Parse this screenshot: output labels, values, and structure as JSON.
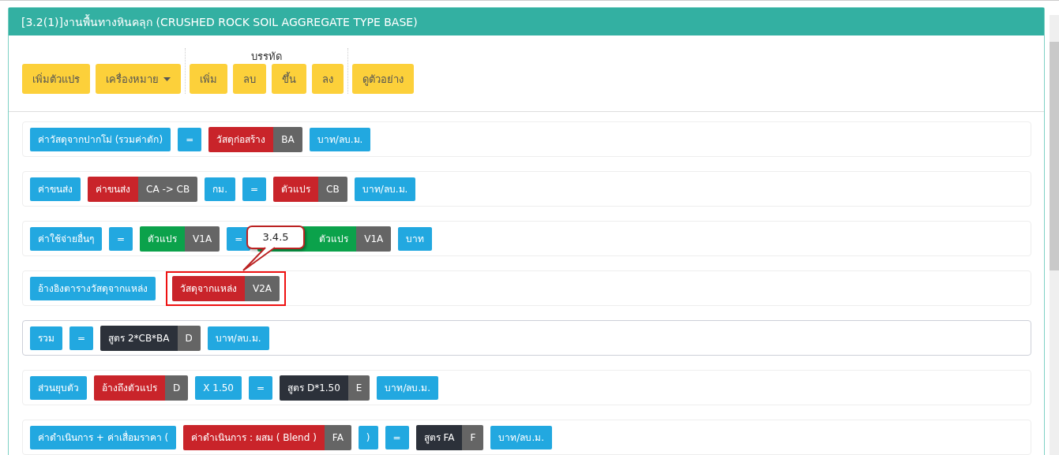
{
  "panel": {
    "title": "[3.2(1)]งานพื้นทางหินคลุก (CRUSHED ROCK SOIL AGGREGATE TYPE BASE)"
  },
  "toolbar": {
    "groups": [
      {
        "buttons": [
          {
            "label": "เพิ่มตัวแปร",
            "dropdown": false
          },
          {
            "label": "เครื่องหมาย",
            "dropdown": true
          }
        ]
      },
      {
        "heading": "บรรทัด",
        "buttons": [
          {
            "label": "เพิ่ม",
            "dropdown": false
          },
          {
            "label": "ลบ",
            "dropdown": false
          },
          {
            "label": "ขึ้น",
            "dropdown": false
          },
          {
            "label": "ลง",
            "dropdown": false
          }
        ]
      },
      {
        "buttons": [
          {
            "label": "ดูตัวอย่าง",
            "dropdown": false
          }
        ]
      }
    ]
  },
  "rows": [
    {
      "selected": false,
      "items": [
        {
          "kind": "text",
          "text": "ค่าวัสดุจากปากโม่ (รวมค่าตัก)"
        },
        {
          "kind": "text",
          "text": "="
        },
        {
          "kind": "ref",
          "text": "วัสดุก่อสร้าง",
          "code": "BA"
        },
        {
          "kind": "text",
          "text": "บาท/ลบ.ม."
        }
      ]
    },
    {
      "selected": false,
      "items": [
        {
          "kind": "text",
          "text": "ค่าขนส่ง"
        },
        {
          "kind": "ref",
          "text": "ค่าขนส่ง",
          "code": "CA -> CB"
        },
        {
          "kind": "text",
          "text": "กม."
        },
        {
          "kind": "text",
          "text": "="
        },
        {
          "kind": "ref",
          "text": "ตัวแปร",
          "code": "CB"
        },
        {
          "kind": "text",
          "text": "บาท/ลบ.ม."
        }
      ]
    },
    {
      "selected": false,
      "items": [
        {
          "kind": "text",
          "text": "ค่าใช้จ่ายอื่นๆ"
        },
        {
          "kind": "text",
          "text": "="
        },
        {
          "kind": "var",
          "text": "ตัวแปร",
          "code": "V1A"
        },
        {
          "kind": "text",
          "text": "="
        },
        {
          "kind": "var",
          "text": "ตัวแปร",
          "code": "V1A",
          "covered": true
        },
        {
          "kind": "text",
          "text": "บาท"
        }
      ]
    },
    {
      "selected": false,
      "items": [
        {
          "kind": "text",
          "text": "อ้างอิงตารางวัสดุจากแหล่ง"
        },
        {
          "kind": "ref",
          "text": "วัสดุจากแหล่ง",
          "code": "V2A",
          "highlighted": true,
          "callout": "3.4.5"
        }
      ]
    },
    {
      "selected": true,
      "items": [
        {
          "kind": "text",
          "text": "รวม"
        },
        {
          "kind": "text",
          "text": "="
        },
        {
          "kind": "formula",
          "text": "สูตร 2*CB*BA",
          "code": "D"
        },
        {
          "kind": "text",
          "text": "บาท/ลบ.ม."
        }
      ]
    },
    {
      "selected": false,
      "items": [
        {
          "kind": "text",
          "text": "ส่วนยุบตัว"
        },
        {
          "kind": "ref",
          "text": "อ้างถึงตัวแปร",
          "code": "D"
        },
        {
          "kind": "text",
          "text": "X 1.50"
        },
        {
          "kind": "text",
          "text": "="
        },
        {
          "kind": "formula",
          "text": "สูตร D*1.50",
          "code": "E"
        },
        {
          "kind": "text",
          "text": "บาท/ลบ.ม."
        }
      ]
    },
    {
      "selected": false,
      "items": [
        {
          "kind": "text",
          "text": "ค่าดำเนินการ + ค่าเสื่อมราคา ("
        },
        {
          "kind": "ref",
          "text": "ค่าดำเนินการ : ผสม ( Blend )",
          "code": "FA"
        },
        {
          "kind": "text",
          "text": ")"
        },
        {
          "kind": "text",
          "text": "="
        },
        {
          "kind": "formula",
          "text": "สูตร FA",
          "code": "F"
        },
        {
          "kind": "text",
          "text": "บาท/ลบ.ม."
        }
      ]
    }
  ]
}
